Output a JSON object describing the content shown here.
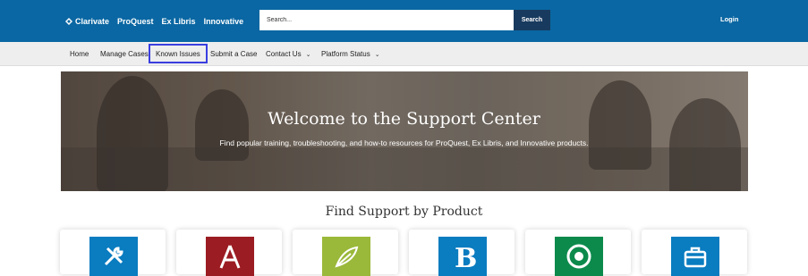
{
  "header": {
    "brand": "Clarivate",
    "sublinks": [
      "ProQuest",
      "Ex Libris",
      "Innovative"
    ],
    "search_placeholder": "Search...",
    "search_button": "Search",
    "login": "Login",
    "background": "#0a67a3"
  },
  "nav": {
    "items": [
      {
        "label": "Home"
      },
      {
        "label": "Manage Cases"
      },
      {
        "label": "Known Issues"
      },
      {
        "label": "Submit a Case"
      },
      {
        "label": "Contact Us"
      },
      {
        "label": "Platform Status"
      }
    ],
    "active": "Known Issues",
    "active_outline": "#3a3ee0"
  },
  "hero": {
    "title": "Welcome to the Support Center",
    "subtitle": "Find popular training, troubleshooting, and how-to resources for ProQuest, Ex Libris, and Innovative products."
  },
  "products": {
    "title": "Find Support by Product",
    "cards": [
      {
        "icon": "tools-icon",
        "color": "#0a7cc0"
      },
      {
        "icon": "alma-a-icon",
        "color": "#9b1c22"
      },
      {
        "icon": "leaf-icon",
        "color": "#9ab83a"
      },
      {
        "icon": "b-letter-icon",
        "color": "#0a7cc0"
      },
      {
        "icon": "swirl-icon",
        "color": "#0c8a4c"
      },
      {
        "icon": "briefcase-icon",
        "color": "#0a7cc0"
      }
    ]
  }
}
